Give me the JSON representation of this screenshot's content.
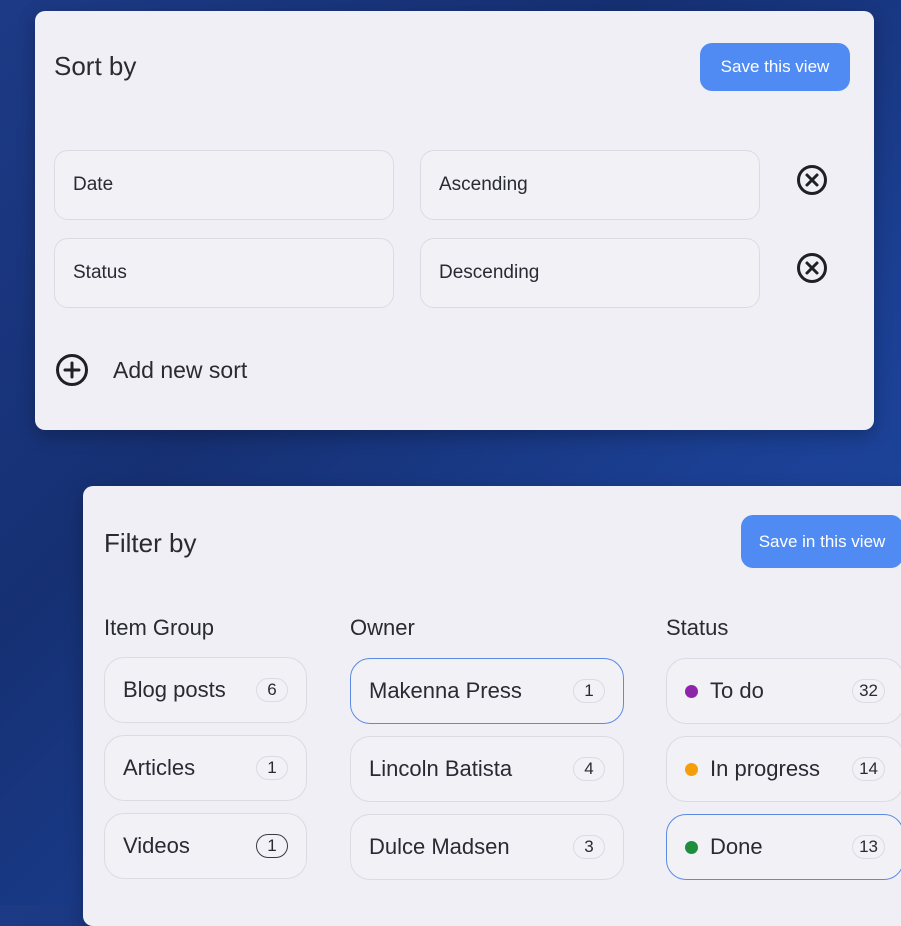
{
  "sort": {
    "title": "Sort by",
    "save_label": "Save this view",
    "rows": [
      {
        "field": "Date",
        "order": "Ascending"
      },
      {
        "field": "Status",
        "order": "Descending"
      }
    ],
    "add_label": "Add new sort"
  },
  "filter": {
    "title": "Filter by",
    "save_label": "Save in this view",
    "columns": [
      {
        "heading": "Item Group",
        "items": [
          {
            "name": "Blog posts",
            "count": "6"
          },
          {
            "name": "Articles",
            "count": "1"
          },
          {
            "name": "Videos",
            "count": "1"
          }
        ]
      },
      {
        "heading": "Owner",
        "items": [
          {
            "name": "Makenna Press",
            "count": "1"
          },
          {
            "name": "Lincoln Batista",
            "count": "4"
          },
          {
            "name": "Dulce Madsen",
            "count": "3"
          }
        ]
      },
      {
        "heading": "Status",
        "items": [
          {
            "name": "To do",
            "count": "32",
            "color": "#8e24aa"
          },
          {
            "name": "In progress",
            "count": "14",
            "color": "#f59e0b"
          },
          {
            "name": "Done",
            "count": "13",
            "color": "#1e8e3e"
          }
        ]
      }
    ]
  },
  "colors": {
    "accent": "#4f8bf3",
    "selected_border": "#5b8ae6"
  }
}
